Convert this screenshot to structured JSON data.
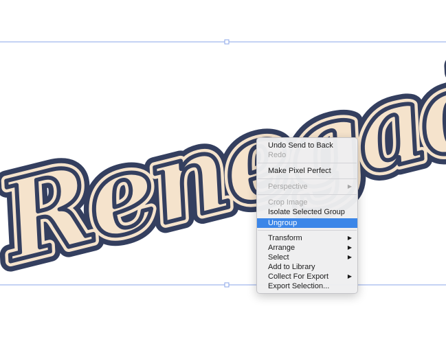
{
  "artwork": {
    "text": "Renegade",
    "fill_color": "#f5e3cc",
    "outline_color": "#343f5f",
    "selection_color": "#8aa4e8"
  },
  "context_menu": {
    "items": [
      {
        "label": "Undo Send to Back",
        "enabled": true
      },
      {
        "label": "Redo",
        "enabled": false
      },
      {
        "label": "Make Pixel Perfect",
        "enabled": true
      },
      {
        "label": "Perspective",
        "enabled": false,
        "submenu": true
      },
      {
        "label": "Crop Image",
        "enabled": false
      },
      {
        "label": "Isolate Selected Group",
        "enabled": true
      },
      {
        "label": "Ungroup",
        "enabled": true,
        "highlighted": true
      },
      {
        "label": "Transform",
        "enabled": true,
        "submenu": true
      },
      {
        "label": "Arrange",
        "enabled": true,
        "submenu": true
      },
      {
        "label": "Select",
        "enabled": true,
        "submenu": true
      },
      {
        "label": "Add to Library",
        "enabled": true
      },
      {
        "label": "Collect For Export",
        "enabled": true,
        "submenu": true
      },
      {
        "label": "Export Selection...",
        "enabled": true
      }
    ],
    "submenu_arrow": "▶",
    "highlight_color": "#3b86e8"
  }
}
